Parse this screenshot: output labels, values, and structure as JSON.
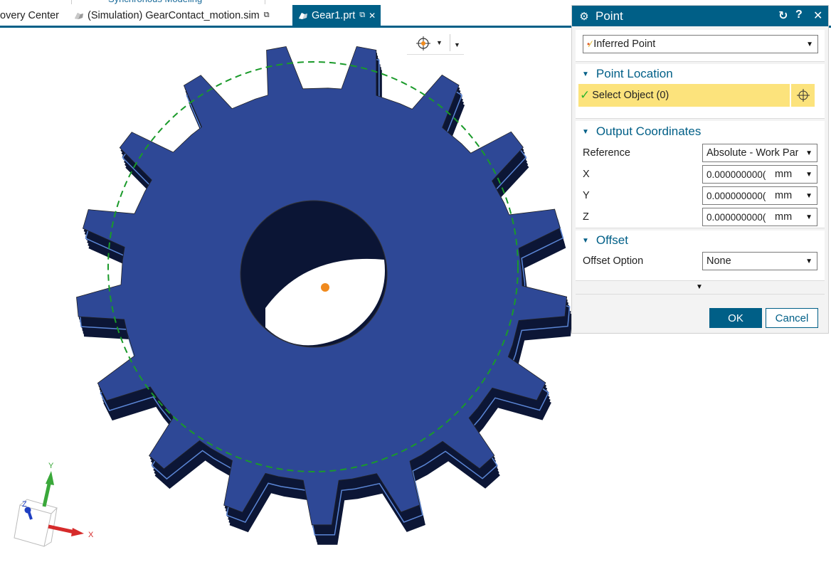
{
  "ribbon": {
    "group_label": "Synchronous Modeling"
  },
  "tabs": [
    {
      "label": "overy Center",
      "active": false,
      "has_doc_icon": false
    },
    {
      "label": "(Simulation) GearContact_motion.sim",
      "active": false,
      "has_doc_icon": true,
      "modified_icon": "external-edit-icon"
    },
    {
      "label": "Gear1.prt",
      "active": true,
      "has_doc_icon": true,
      "modified_icon": "external-edit-icon",
      "close_icon": "✕"
    }
  ],
  "viewport": {
    "snap_tool": {
      "icon": "point-snap-icon",
      "dropdown": "▼"
    },
    "model": {
      "type": "spur-gear",
      "teeth": 17,
      "face_color": "#2e4896",
      "side_color": "#0c1636",
      "edge_color": "#5b86d6",
      "pitch_circle_color": "#1a9a2a",
      "center_point_color": "#f08a1e"
    },
    "triad": {
      "x_label": "X",
      "y_label": "Y",
      "z_label": "Z",
      "x_color": "#d62b2b",
      "y_color": "#3aa83a",
      "z_color": "#1f3fc2"
    }
  },
  "dialog": {
    "title": "Point",
    "title_icon": "gear-icon",
    "buttons": {
      "reset": "↻",
      "help": "?",
      "close": "✕"
    },
    "type_dropdown": {
      "value": "Inferred Point",
      "icon": "inferred-point-icon"
    },
    "sections": {
      "point_location": {
        "label": "Point Location",
        "select_object": {
          "label": "Select Object (0)",
          "status_icon": "✓",
          "snap_icon": "crosshair-icon"
        }
      },
      "output_coordinates": {
        "label": "Output Coordinates",
        "reference": {
          "label": "Reference",
          "value": "Absolute - Work Par"
        },
        "x": {
          "label": "X",
          "value": "0.000000000(",
          "unit": "mm"
        },
        "y": {
          "label": "Y",
          "value": "0.000000000(",
          "unit": "mm"
        },
        "z": {
          "label": "Z",
          "value": "0.000000000(",
          "unit": "mm"
        }
      },
      "offset": {
        "label": "Offset",
        "option": {
          "label": "Offset Option",
          "value": "None"
        }
      }
    },
    "more_icon": "▼",
    "ok_label": "OK",
    "cancel_label": "Cancel",
    "accent_color": "#005f87",
    "highlight_color": "#fce37c"
  }
}
